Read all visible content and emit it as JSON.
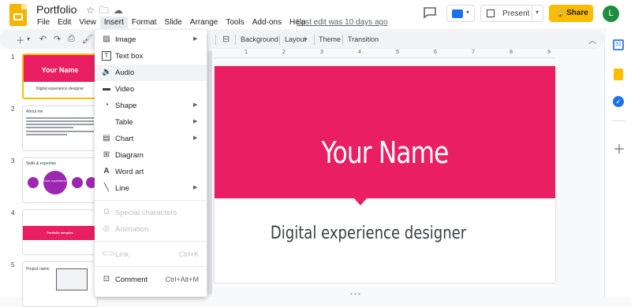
{
  "app": {
    "title": "Portfolio",
    "avatar_letter": "L",
    "brand_color": "#f4b400",
    "share_color": "#fbbc04"
  },
  "menubar": {
    "items": [
      "File",
      "Edit",
      "View",
      "Insert",
      "Format",
      "Slide",
      "Arrange",
      "Tools",
      "Add-ons",
      "Help"
    ],
    "active": "Insert",
    "last_edit": "Last edit was 10 days ago"
  },
  "header_buttons": {
    "present_label": "Present",
    "share_label": "Share"
  },
  "toolbar": {
    "background_label": "Background",
    "layout_label": "Layout",
    "theme_label": "Theme",
    "transition_label": "Transition"
  },
  "insert_menu": {
    "items": [
      {
        "label": "Image",
        "icon": "image-icon",
        "submenu": true
      },
      {
        "label": "Text box",
        "icon": "text-box-icon"
      },
      {
        "label": "Audio",
        "icon": "audio-icon",
        "highlighted": true
      },
      {
        "label": "Video",
        "icon": "video-icon"
      },
      {
        "label": "Shape",
        "icon": "shape-icon",
        "submenu": true
      },
      {
        "label": "Table",
        "icon": "",
        "submenu": true
      },
      {
        "label": "Chart",
        "icon": "chart-icon",
        "submenu": true
      },
      {
        "label": "Diagram",
        "icon": "diagram-icon"
      },
      {
        "label": "Word art",
        "icon": "word-art-icon"
      },
      {
        "label": "Line",
        "icon": "line-icon",
        "submenu": true
      },
      {
        "label": "Special characters",
        "icon": "omega-icon",
        "disabled": true
      },
      {
        "label": "Animation",
        "icon": "animation-icon",
        "disabled": true
      },
      {
        "label": "Link",
        "icon": "link-icon",
        "disabled": true,
        "shortcut": "Ctrl+K"
      },
      {
        "label": "Comment",
        "icon": "comment-icon",
        "shortcut": "Ctrl+Alt+M"
      }
    ]
  },
  "filmstrip": {
    "slides": [
      {
        "number": "1",
        "title": "Your Name",
        "subtitle": "Digital experience designer"
      },
      {
        "number": "2",
        "title": "About me"
      },
      {
        "number": "3",
        "title": "Skills & expertise",
        "center": "User experience"
      },
      {
        "number": "4",
        "title": "Portfolio samples"
      },
      {
        "number": "5",
        "title": "Project name"
      }
    ]
  },
  "ruler": {
    "marks": [
      "1",
      "2",
      "3",
      "4",
      "5",
      "6",
      "7",
      "8",
      "9"
    ]
  },
  "slide": {
    "title": "Your Name",
    "subtitle": "Digital experience designer",
    "accent_color": "#e91e63"
  }
}
